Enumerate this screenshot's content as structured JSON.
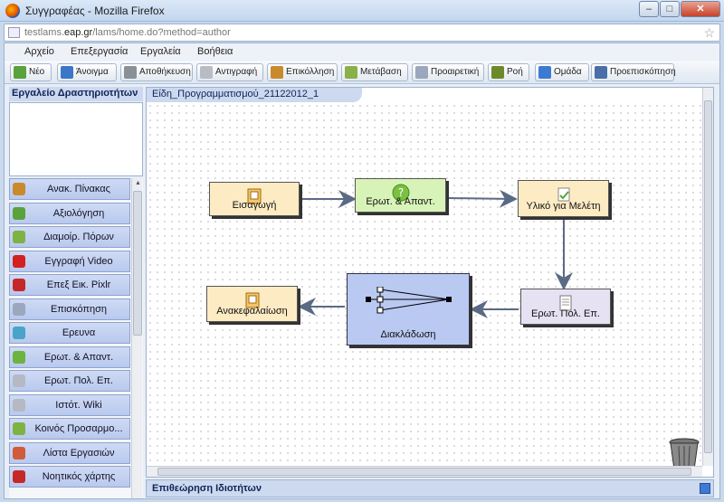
{
  "window": {
    "title": "Συγγραφέας - Mozilla Firefox",
    "min": "–",
    "max": "□",
    "close": "✕"
  },
  "browser": {
    "url_prefix": "testlams.",
    "url_domain": "eap.gr",
    "url_path": "/lams/home.do?method=author"
  },
  "menu": [
    "Αρχείο",
    "Επεξεργασία",
    "Εργαλεία",
    "Βοήθεια"
  ],
  "toolbar": [
    {
      "label": "Νέο",
      "icon": "new-icon",
      "color": "#5aa23c"
    },
    {
      "label": "Άνοιγμα",
      "icon": "folder-open-icon",
      "color": "#3b77c9"
    },
    {
      "label": "Αποθήκευση",
      "icon": "save-icon",
      "color": "#8a8f99"
    },
    {
      "label": "Αντιγραφή",
      "icon": "copy-icon",
      "color": "#b7bcc5"
    },
    {
      "label": "Επικόλληση",
      "icon": "paste-icon",
      "color": "#c98a2b"
    },
    {
      "label": "Μετάβαση",
      "icon": "pencil-icon",
      "color": "#8ab04a"
    },
    {
      "label": "Προαιρετική",
      "icon": "optional-icon",
      "color": "#9aa7bd"
    },
    {
      "label": "Ροή",
      "icon": "flow-icon",
      "color": "#6c8a2a"
    },
    {
      "label": "Ομάδα",
      "icon": "group-icon",
      "color": "#3d7bd2"
    },
    {
      "label": "Προεπισκόπηση",
      "icon": "preview-icon",
      "color": "#4a6fa8"
    }
  ],
  "left_panel": {
    "header": "Εργαλείο Δραστηριοτήτων",
    "tools": [
      {
        "label": "Ανακ. Πίνακας",
        "icon": "noticeboard-icon",
        "color": "#c98a2b"
      },
      {
        "label": "Αξιολόγηση",
        "icon": "assessment-icon",
        "color": "#5aa23c"
      },
      {
        "label": "Διαμοίρ. Πόρων",
        "icon": "share-resources-icon",
        "color": "#7cb342"
      },
      {
        "label": "Εγγραφή Video",
        "icon": "video-record-icon",
        "color": "#d32020"
      },
      {
        "label": "Επεξ Εικ. Pixlr",
        "icon": "pixlr-icon",
        "color": "#c62828"
      },
      {
        "label": "Επισκόπηση",
        "icon": "overview-icon",
        "color": "#9aa7bd"
      },
      {
        "label": "Ερευνα",
        "icon": "survey-icon",
        "color": "#4aa3c9"
      },
      {
        "label": "Ερωτ. & Απαντ.",
        "icon": "qa-icon",
        "color": "#6cb33f"
      },
      {
        "label": "Ερωτ. Πολ. Επ.",
        "icon": "mcq-icon",
        "color": "#b5b9c4"
      },
      {
        "label": "Ιστότ. Wiki",
        "icon": "wiki-icon",
        "color": "#b5b9c4"
      },
      {
        "label": "Κοινός Προσαρμο...",
        "icon": "shared-adapt-icon",
        "color": "#7cb342"
      },
      {
        "label": "Λίστα Εργασιών",
        "icon": "task-list-icon",
        "color": "#d05a3a"
      },
      {
        "label": "Νοητικός χάρτης",
        "icon": "mindmap-icon",
        "color": "#c62828"
      }
    ]
  },
  "canvas": {
    "tab": "Είδη_Προγραμματισμού_21122012_1",
    "nodes": [
      {
        "id": "intro",
        "label": "Εισαγωγή",
        "icon": "notebook-icon",
        "bg": "#fdebc4"
      },
      {
        "id": "qa",
        "label": "Ερωτ. & Απαντ.",
        "icon": "question-icon",
        "bg": "#d8f3b8"
      },
      {
        "id": "study",
        "label": "Υλικό για Μελέτη",
        "icon": "study-material-icon",
        "bg": "#fdebc4"
      },
      {
        "id": "mcq",
        "label": "Ερωτ. Πολ. Επ.",
        "icon": "mcq-sheet-icon",
        "bg": "#e6e1f3"
      },
      {
        "id": "branch",
        "label": "Διακλάδωση",
        "icon": "branching-icon",
        "bg": "#b9c9f2"
      },
      {
        "id": "summary",
        "label": "Ανακεφαλαίωση",
        "icon": "notebook-icon",
        "bg": "#fdebc4"
      }
    ]
  },
  "properties": {
    "label": "Επιθεώρηση Ιδιοτήτων"
  }
}
